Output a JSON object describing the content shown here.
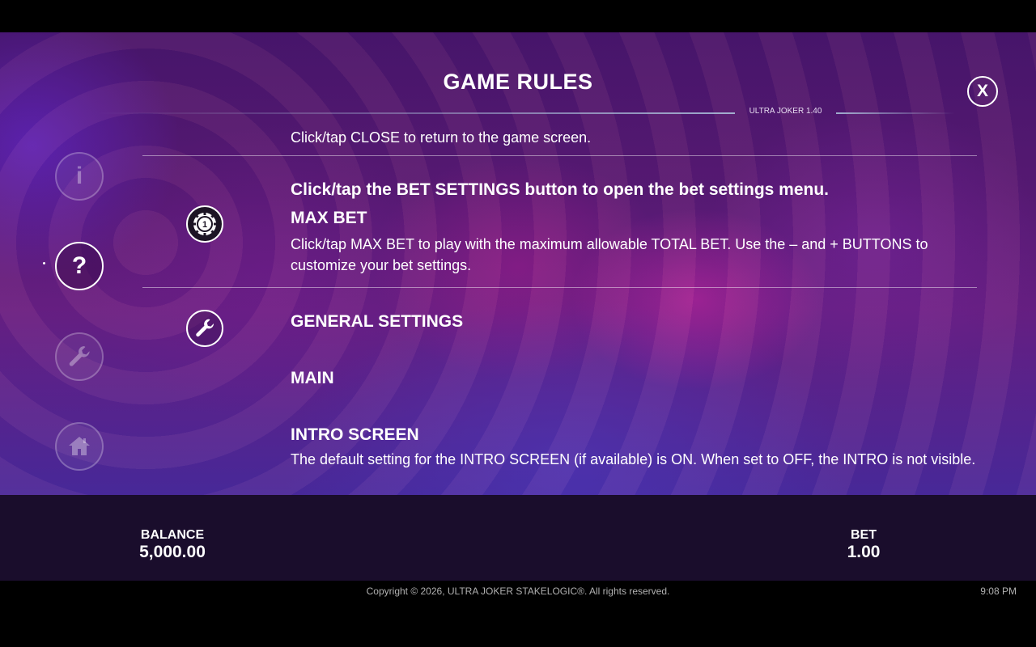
{
  "header": {
    "title": "GAME RULES",
    "version": "ULTRA JOKER 1.40",
    "close_label": "X"
  },
  "nav": {
    "info_glyph": "i",
    "help_glyph": "?",
    "active": "help"
  },
  "content": {
    "cut_line": "Click/tap CLOSE to return to the game screen.",
    "bet_settings": {
      "icon": "bet-chip-icon",
      "lead": "Click/tap the BET SETTINGS button to open the bet settings menu.",
      "heading": "MAX BET",
      "body": "Click/tap MAX BET to play with the maximum allowable TOTAL BET. Use the – and + BUTTONS to customize your bet settings."
    },
    "general_settings": {
      "icon": "wrench-icon",
      "heading": "GENERAL SETTINGS",
      "sub_heading": "MAIN",
      "intro_heading": "INTRO SCREEN",
      "intro_body": "The default setting for the INTRO SCREEN (if available) is ON. When set to OFF, the INTRO is not visible."
    }
  },
  "bottom": {
    "balance_label": "BALANCE",
    "balance_value": "5,000.00",
    "bet_label": "BET",
    "bet_value": "1.00"
  },
  "footer": {
    "copyright": "Copyright © 2026, ULTRA JOKER STAKELOGIC®. All rights reserved.",
    "time": "9:08 PM"
  }
}
